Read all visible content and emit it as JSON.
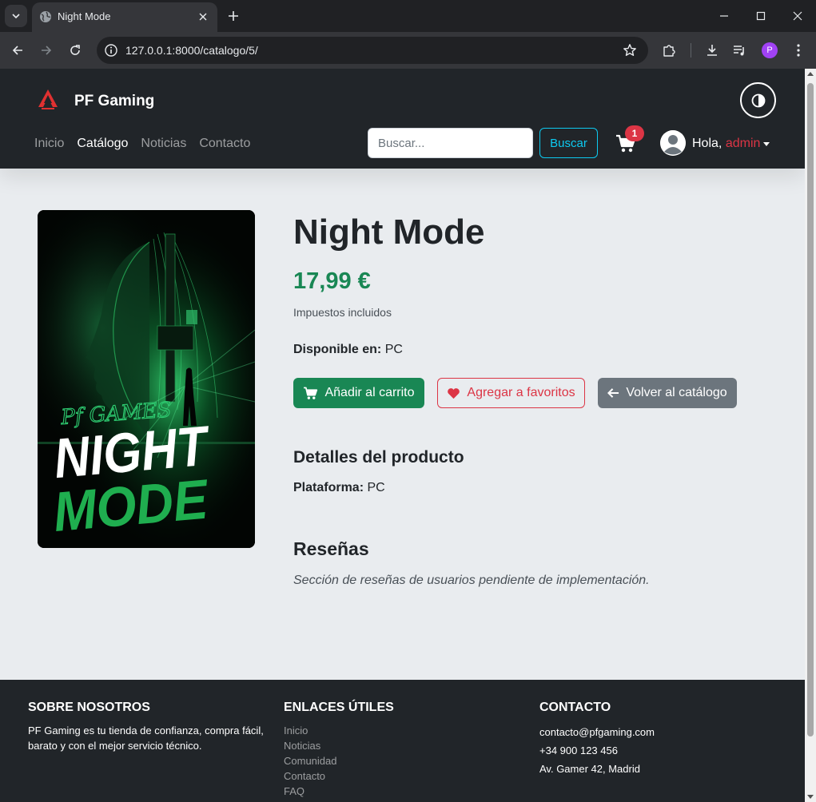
{
  "browser": {
    "tab_title": "Night Mode",
    "url": "127.0.0.1:8000/catalogo/5/",
    "profile_initial": "P"
  },
  "site": {
    "brand": "PF Gaming",
    "nav": [
      "Inicio",
      "Catálogo",
      "Noticias",
      "Contacto"
    ],
    "active_nav": "Catálogo",
    "search_placeholder": "Buscar...",
    "search_button": "Buscar",
    "cart_count": "1",
    "greeting": "Hola,",
    "username": "admin"
  },
  "product": {
    "title": "Night Mode",
    "price": "17,99 €",
    "tax_note": "Impuestos incluidos",
    "available_label": "Disponible en:",
    "available_value": "PC",
    "add_to_cart": "Añadir al carrito",
    "add_to_favorites": "Agregar a favoritos",
    "back_to_catalog": "Volver al catálogo",
    "details_heading": "Detalles del producto",
    "platform_label": "Plataforma:",
    "platform_value": "PC",
    "reviews_heading": "Reseñas",
    "reviews_note": "Sección de reseñas de usuarios pendiente de implementación.",
    "cover": {
      "studio": "Pf GAMES",
      "line1": "NIGHT",
      "line2": "MODE"
    }
  },
  "footer": {
    "about_heading": "SOBRE NOSOTROS",
    "about_text": "PF Gaming es tu tienda de confianza, compra fácil, barato y con el mejor servicio técnico.",
    "links_heading": "ENLACES ÚTILES",
    "links": [
      "Inicio",
      "Noticias",
      "Comunidad",
      "Contacto",
      "FAQ"
    ],
    "contact_heading": "CONTACTO",
    "email": "contacto@pfgaming.com",
    "phone": "+34 900 123 456",
    "address": "Av. Gamer 42, Madrid"
  },
  "colors": {
    "price_green": "#198754",
    "danger_red": "#dc3545",
    "info_cyan": "#0dcaf0",
    "secondary_gray": "#6c757d",
    "navbar_dark": "#212529"
  }
}
